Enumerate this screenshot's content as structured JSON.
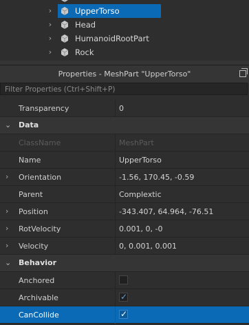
{
  "explorer": {
    "items": [
      {
        "label": "UpperTorso",
        "selected": true,
        "icon": "meshpart-icon"
      },
      {
        "label": "Head",
        "selected": false,
        "icon": "meshpart-icon"
      },
      {
        "label": "HumanoidRootPart",
        "selected": false,
        "icon": "meshpart-icon"
      },
      {
        "label": "Rock",
        "selected": false,
        "icon": "meshpart-icon"
      }
    ]
  },
  "properties": {
    "title": "Properties - MeshPart \"UpperTorso\"",
    "filter_placeholder": "Filter Properties (Ctrl+Shift+P)",
    "rows": [
      {
        "kind": "prop",
        "name": "Transparency",
        "value": "0"
      },
      {
        "kind": "cat",
        "name": "Data"
      },
      {
        "kind": "prop",
        "name": "ClassName",
        "value": "MeshPart",
        "disabled": true
      },
      {
        "kind": "prop",
        "name": "Name",
        "value": "UpperTorso"
      },
      {
        "kind": "prop",
        "name": "Orientation",
        "value": "-1.56, 170.45, -0.59",
        "expandable": true
      },
      {
        "kind": "prop",
        "name": "Parent",
        "value": "Complextic"
      },
      {
        "kind": "prop",
        "name": "Position",
        "value": "-343.407, 64.964, -76.51",
        "expandable": true
      },
      {
        "kind": "prop",
        "name": "RotVelocity",
        "value": "0.001, 0, -0",
        "expandable": true
      },
      {
        "kind": "prop",
        "name": "Velocity",
        "value": "0, 0.001, 0.001",
        "expandable": true
      },
      {
        "kind": "cat",
        "name": "Behavior"
      },
      {
        "kind": "prop",
        "name": "Anchored",
        "checkbox": true,
        "checked": false
      },
      {
        "kind": "prop",
        "name": "Archivable",
        "checkbox": true,
        "checked": true
      },
      {
        "kind": "prop",
        "name": "CanCollide",
        "checkbox": true,
        "checked": true,
        "selected": true
      }
    ]
  },
  "colors": {
    "selection": "#0a6ab5",
    "panel": "#2e2e2e",
    "header": "#353535"
  }
}
